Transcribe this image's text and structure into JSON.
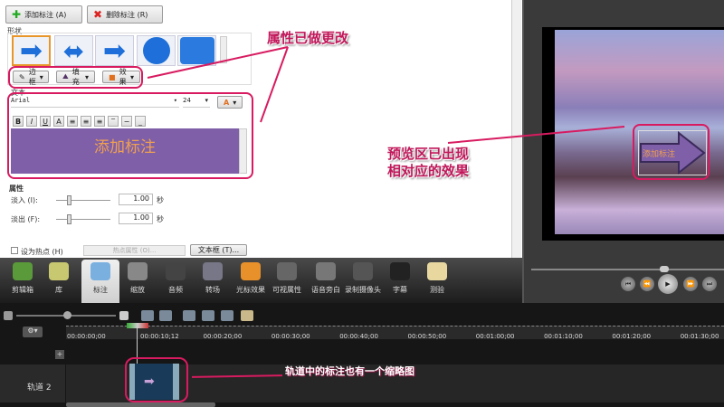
{
  "buttons": {
    "add": "添加标注 (A)",
    "delete": "删除标注 (R)"
  },
  "shape_section": "形状",
  "style_buttons": {
    "border": "边框",
    "fill": "填充",
    "effects": "效果"
  },
  "text_section": "文本",
  "font": {
    "family": "Arial",
    "size": "24"
  },
  "callout_text": "添加标注",
  "properties": {
    "title": "属性",
    "fade_in_label": "淡入 (I):",
    "fade_in_value": "1.00",
    "fade_out_label": "淡出 (F):",
    "fade_out_value": "1.00",
    "unit": "秒",
    "hotspot_label": "设为热点 (H)",
    "hotspot_props": "热点属性 (O)...",
    "textbox": "文本框 (T)..."
  },
  "toolbar": [
    "剪辑箱",
    "库",
    "标注",
    "缩放",
    "音频",
    "转场",
    "光标效果",
    "可视属性",
    "语音旁白",
    "录制摄像头",
    "字幕",
    "测验"
  ],
  "annotations": {
    "top": "属性已做更改",
    "preview_line1": "预览区已出现",
    "preview_line2": "相对应的效果",
    "track": "轨道中的标注也有一个缩略图"
  },
  "preview_callout": "添加标注",
  "timeline": {
    "ticks": [
      "00:00:00;00",
      "00:00:10;12",
      "00:00:20;00",
      "00:00:30;00",
      "00:00:40;00",
      "00:00:50;00",
      "00:01:00;00",
      "00:01:10;00",
      "00:01:20;00",
      "00:01:30;00"
    ],
    "track_name": "轨道 2"
  },
  "colors": {
    "accent": "#d81b60",
    "callout": "#7e5fa8",
    "callout_text": "#f0a050"
  }
}
